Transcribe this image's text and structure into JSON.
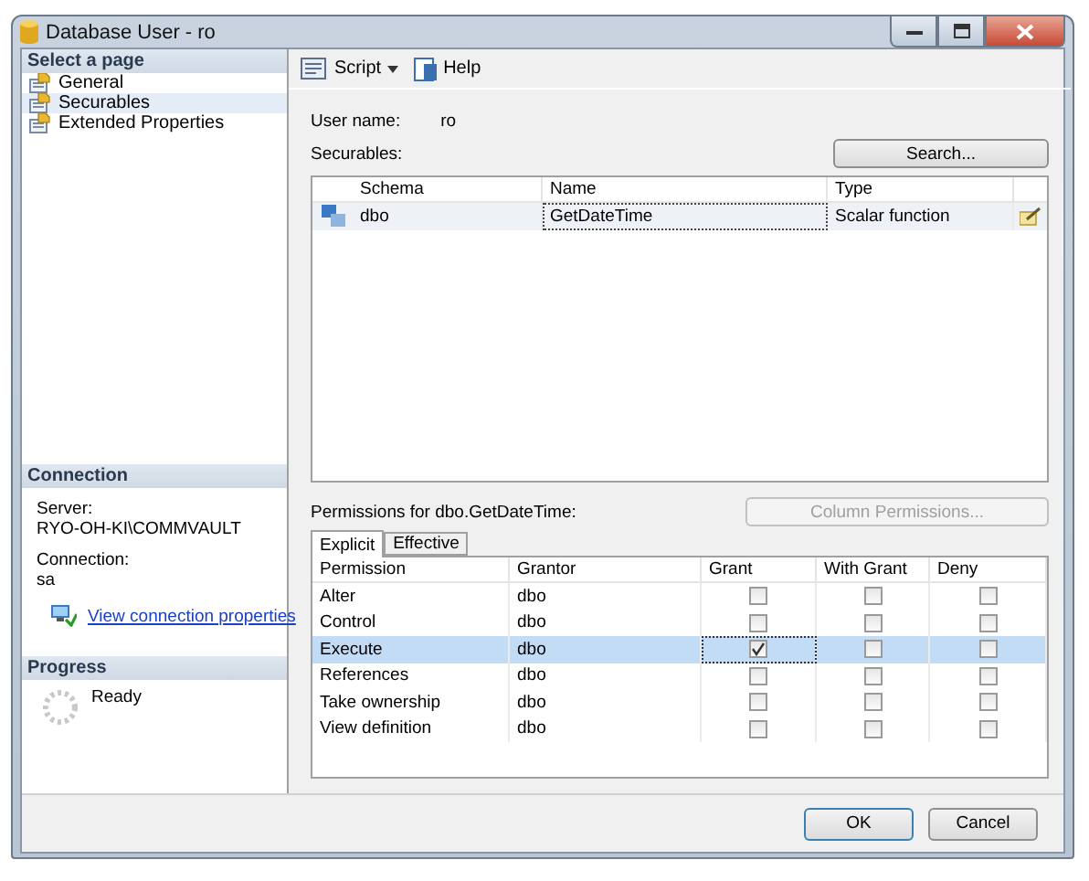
{
  "window": {
    "title": "Database User - ro"
  },
  "sidebar": {
    "header": "Select a page",
    "pages": [
      {
        "label": "General",
        "selected": false
      },
      {
        "label": "Securables",
        "selected": true
      },
      {
        "label": "Extended Properties",
        "selected": false
      }
    ],
    "connection": {
      "header": "Connection",
      "server_label": "Server:",
      "server": "RYO-OH-KI\\COMMVAULT",
      "connection_label": "Connection:",
      "connection": "sa",
      "link": "View connection properties"
    },
    "progress": {
      "header": "Progress",
      "status": "Ready"
    }
  },
  "toolbar": [
    {
      "label": "Script",
      "kind": "script"
    },
    {
      "label": "Help",
      "kind": "help"
    }
  ],
  "user_name": {
    "label": "User name:",
    "value": "ro"
  },
  "securables": {
    "label": "Securables:",
    "search_button": "Search...",
    "columns": [
      "Schema",
      "Name",
      "Type"
    ],
    "rows": [
      {
        "schema": "dbo",
        "name": "GetDateTime",
        "type": "Scalar function",
        "selected": true
      }
    ]
  },
  "permissions": {
    "label": "Permissions for dbo.GetDateTime:",
    "column_button": {
      "label": "Column Permissions...",
      "disabled": true
    },
    "tabs": [
      {
        "label": "Explicit",
        "selected": true
      },
      {
        "label": "Effective",
        "selected": false
      }
    ],
    "columns": [
      "Permission",
      "Grantor",
      "Grant",
      "With Grant",
      "Deny"
    ],
    "rows": [
      {
        "permission": "Alter",
        "grantor": "dbo",
        "grant": false,
        "with_grant": false,
        "deny": false,
        "selected": false
      },
      {
        "permission": "Control",
        "grantor": "dbo",
        "grant": false,
        "with_grant": false,
        "deny": false,
        "selected": false
      },
      {
        "permission": "Execute",
        "grantor": "dbo",
        "grant": true,
        "with_grant": false,
        "deny": false,
        "selected": true
      },
      {
        "permission": "References",
        "grantor": "dbo",
        "grant": false,
        "with_grant": false,
        "deny": false,
        "selected": false
      },
      {
        "permission": "Take ownership",
        "grantor": "dbo",
        "grant": false,
        "with_grant": false,
        "deny": false,
        "selected": false
      },
      {
        "permission": "View definition",
        "grantor": "dbo",
        "grant": false,
        "with_grant": false,
        "deny": false,
        "selected": false
      }
    ]
  },
  "buttons": [
    {
      "label": "OK",
      "default": true
    },
    {
      "label": "Cancel",
      "default": false
    }
  ]
}
